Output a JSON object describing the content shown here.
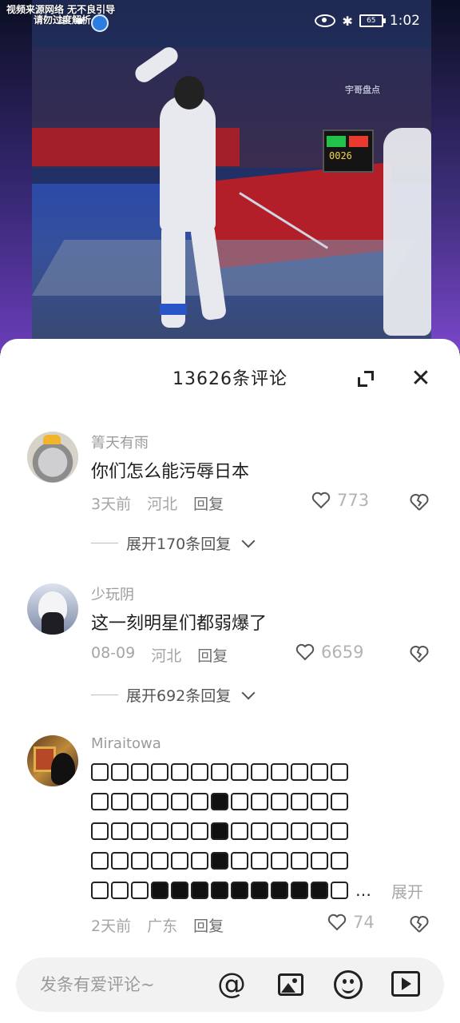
{
  "overlay": {
    "source_line1": "视频来源网络 无不良引导",
    "source_line2": "请勿过度解析",
    "watermark": "宇哥盘点",
    "scoreboard": "0026"
  },
  "statusbar": {
    "time": "1:02",
    "battery": "65"
  },
  "sheet": {
    "title": "13626条评论"
  },
  "comments": [
    {
      "user": "箐天有雨",
      "text": "你们怎么能污辱日本",
      "time": "3天前",
      "location": "河北",
      "reply": "回复",
      "likes": "773",
      "expand": "展开170条回复"
    },
    {
      "user": "少玩阴",
      "text": "这一刻明星们都弱爆了",
      "time": "08-09",
      "location": "河北",
      "reply": "回复",
      "likes": "6659",
      "expand": "展开692条回复"
    },
    {
      "user": "Miraitowa",
      "more": "…",
      "expand_link": "展开",
      "time": "2天前",
      "location": "广东",
      "reply": "回复",
      "likes": "74"
    }
  ],
  "input": {
    "placeholder": "发条有爱评论~"
  },
  "icons": {
    "expand": "expand-icon",
    "close": "close-icon",
    "like": "heart-icon",
    "dislike": "broken-heart-icon",
    "at": "at-icon",
    "image": "image-icon",
    "emoji": "emoji-icon",
    "video": "video-icon"
  },
  "colors": {
    "sheet_bg": "#ffffff",
    "text_primary": "#1f1f1f",
    "text_secondary": "#a5a5a5",
    "input_bg": "#f2f2f2"
  }
}
